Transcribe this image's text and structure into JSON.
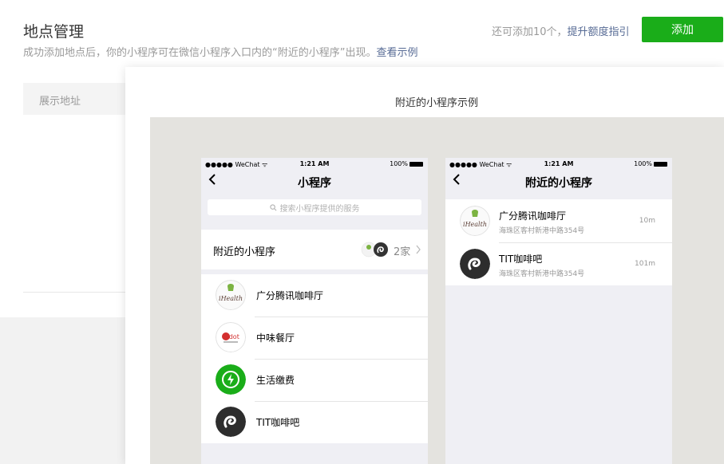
{
  "header": {
    "title": "地点管理",
    "subtitle": "成功添加地点后，你的小程序可在微信小程序入口内的“附近的小程序”出现。",
    "example_link": "查看示例",
    "quota_text": "还可添加10个，",
    "quota_link": "提升额度指引",
    "add_label": "添加"
  },
  "table": {
    "column": "展示地址"
  },
  "popover": {
    "title": "附近的小程序示例",
    "left_phone": {
      "carrier": "●●●●● WeChat ",
      "time": "1:21 AM",
      "battery": "100%",
      "nav_title": "小程序",
      "search_placeholder": "搜索小程序提供的服务",
      "nearby_label": "附近的小程序",
      "nearby_count": "2家",
      "items": [
        {
          "name": "广分腾讯咖啡厅",
          "logo": "ihealth-logo"
        },
        {
          "name": "中味餐厅",
          "logo": "mdot-logo"
        },
        {
          "name": "生活缴费",
          "logo": "bolt-icon"
        },
        {
          "name": "TIT咖啡吧",
          "logo": "miniprogram-icon"
        }
      ]
    },
    "right_phone": {
      "carrier": "●●●●● WeChat ",
      "time": "1:21 AM",
      "battery": "100%",
      "nav_title": "附近的小程序",
      "items": [
        {
          "name": "广分腾讯咖啡厅",
          "address": "海珠区客村新港中路354号",
          "distance": "10m"
        },
        {
          "name": "TIT咖啡吧",
          "address": "海珠区客村新港中路354号",
          "distance": "101m"
        }
      ]
    }
  },
  "colors": {
    "accent": "#1aad19",
    "link": "#576b95"
  }
}
